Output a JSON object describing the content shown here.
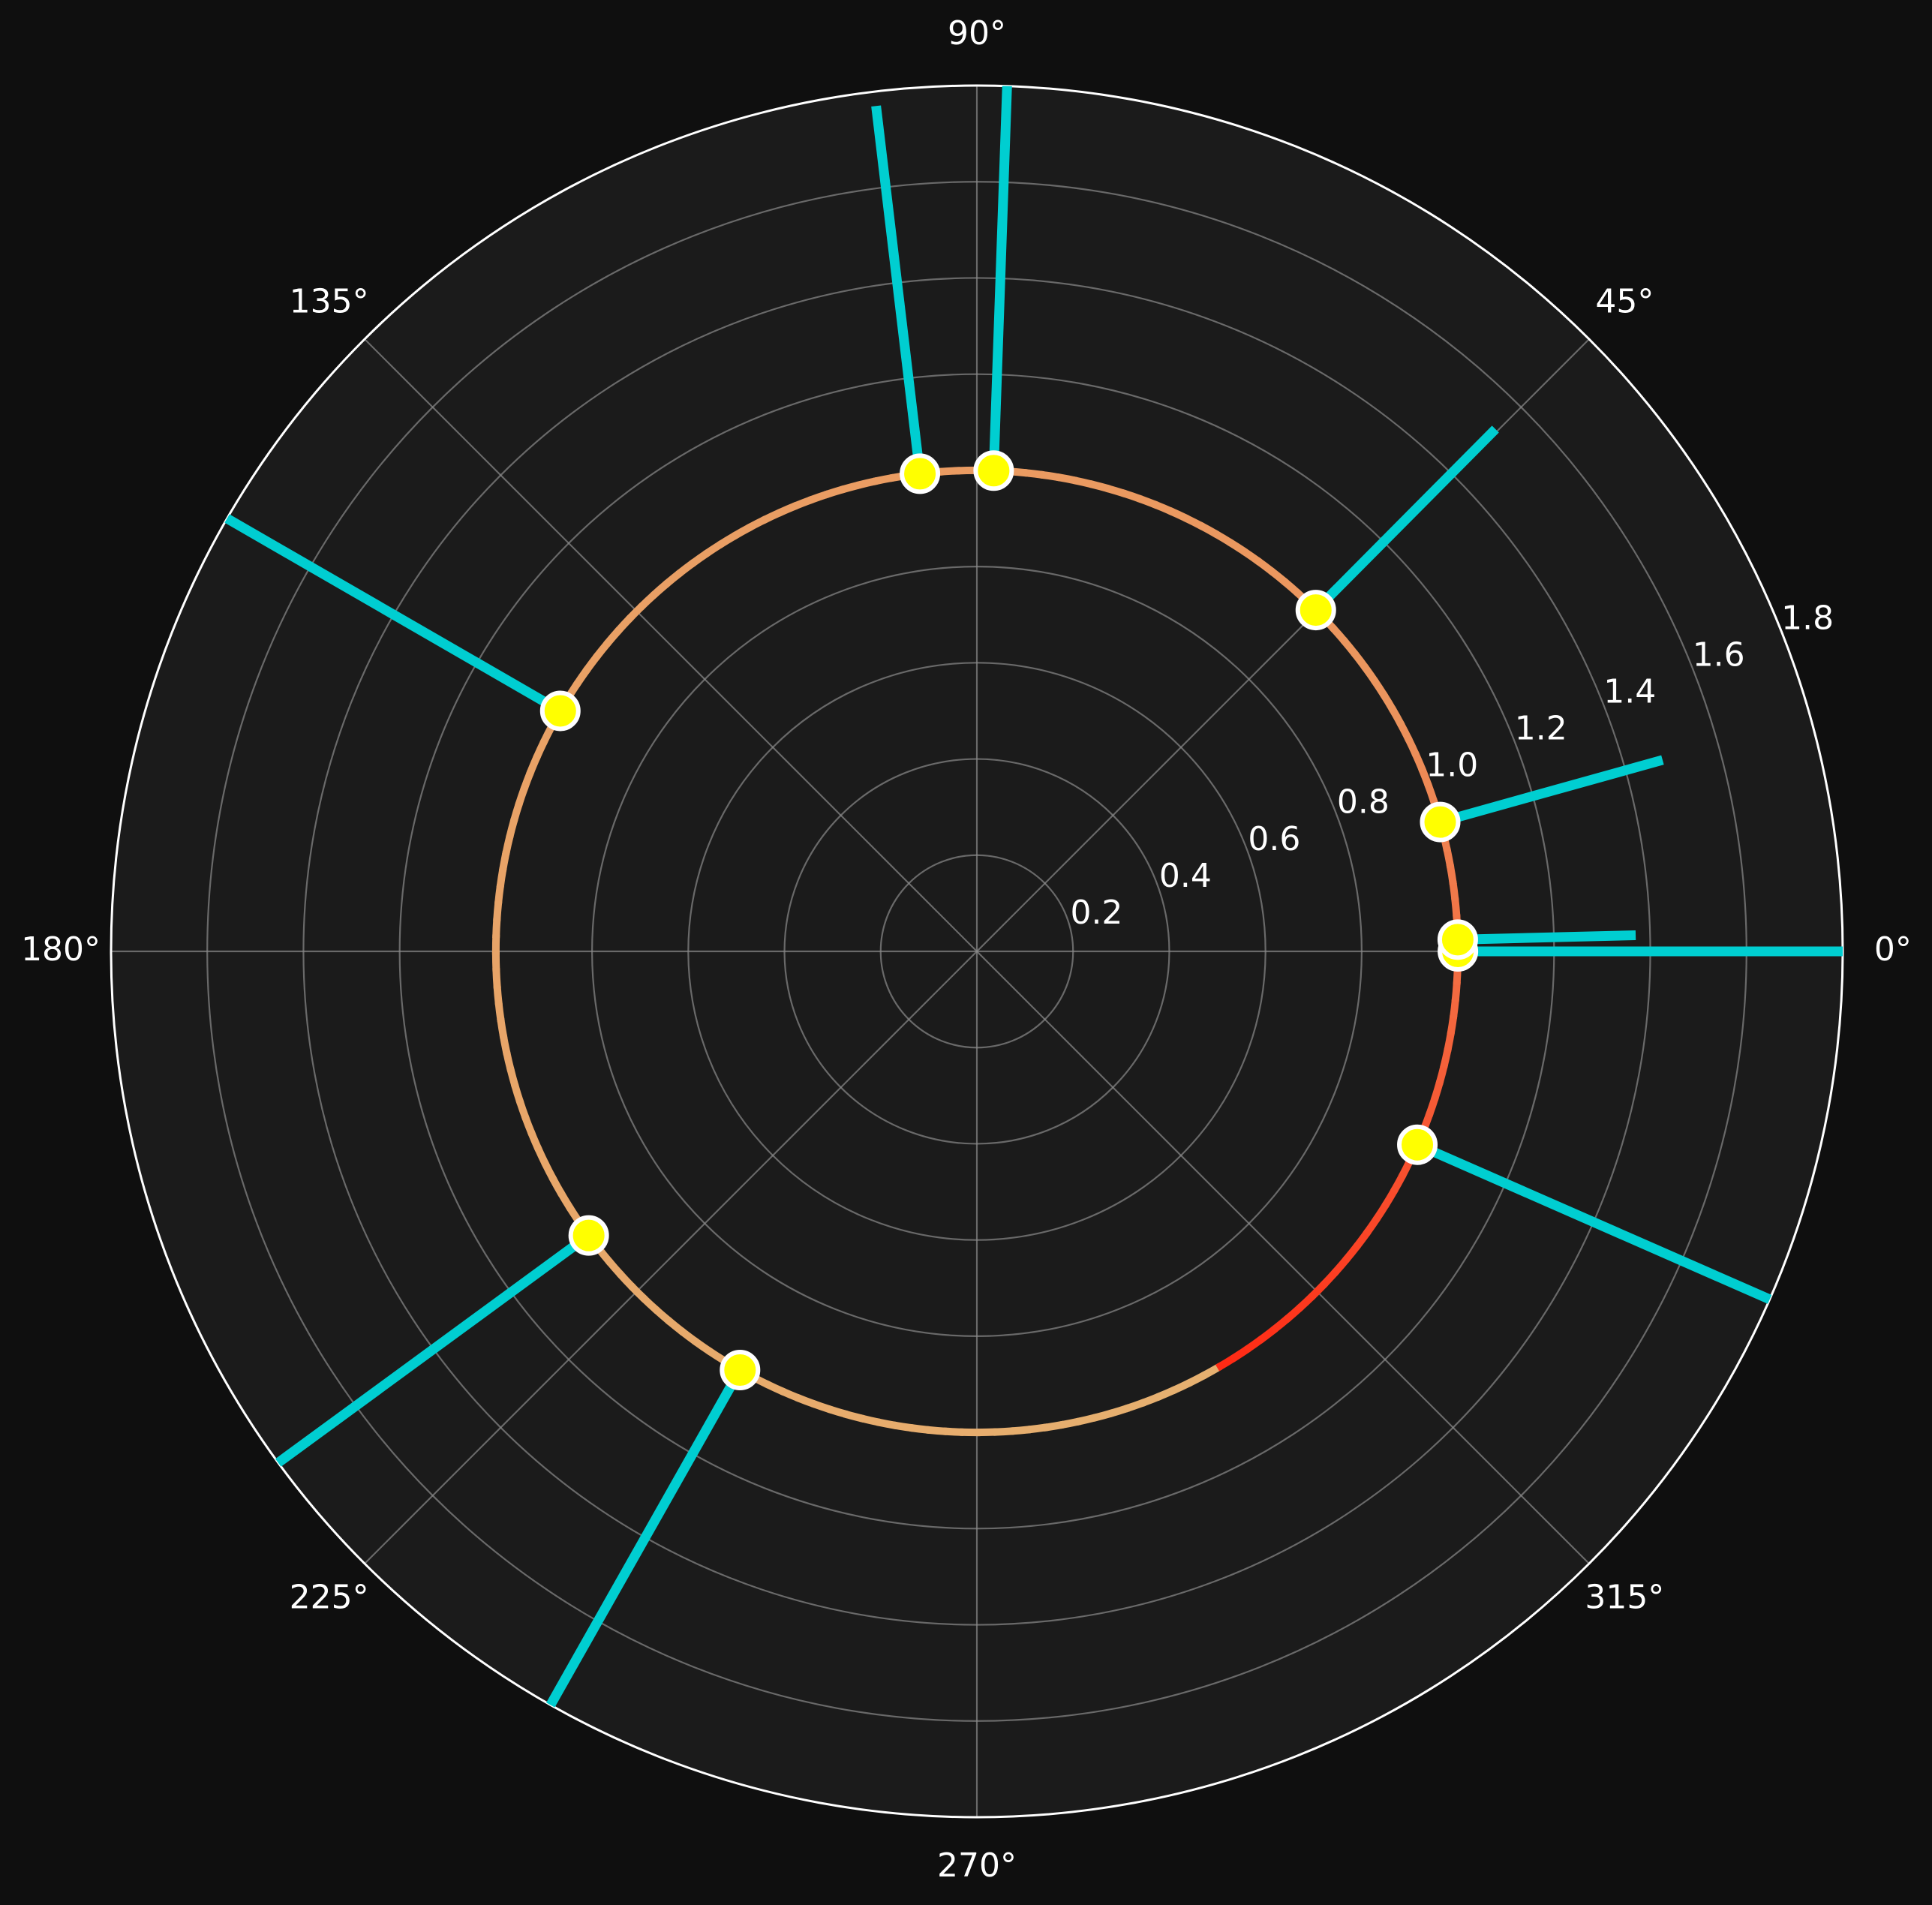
{
  "chart_data": {
    "type": "polar",
    "theta_tick_labels": [
      "0°",
      "45°",
      "90°",
      "135°",
      "180°",
      "225°",
      "270°",
      "315°"
    ],
    "theta_ticks_deg": [
      0,
      45,
      90,
      135,
      180,
      225,
      270,
      315
    ],
    "r_tick_labels": [
      "0.2",
      "0.4",
      "0.6",
      "0.8",
      "1.0",
      "1.2",
      "1.4",
      "1.6",
      "1.8"
    ],
    "r_ticks": [
      0.2,
      0.4,
      0.6,
      0.8,
      1.0,
      1.2,
      1.4,
      1.6,
      1.8
    ],
    "rlim": [
      0,
      1.8
    ],
    "rlabel_position_deg": 22.5,
    "grid": true,
    "circle": {
      "r": 1.0,
      "color_start": "#ff2a14",
      "color_end": "#e6b070",
      "start_angle_deg": 0
    },
    "points": [
      {
        "theta_deg": 0.0,
        "r": 1.0
      },
      {
        "theta_deg": 1.4,
        "r": 1.0
      },
      {
        "theta_deg": 15.6,
        "r": 1.0
      },
      {
        "theta_deg": 45.2,
        "r": 1.0
      },
      {
        "theta_deg": 88.0,
        "r": 1.0
      },
      {
        "theta_deg": 96.8,
        "r": 1.0
      },
      {
        "theta_deg": 150.0,
        "r": 1.0
      },
      {
        "theta_deg": 216.2,
        "r": 1.0
      },
      {
        "theta_deg": 240.5,
        "r": 1.0
      },
      {
        "theta_deg": 336.3,
        "r": 1.0
      }
    ],
    "stems": [
      {
        "theta_deg": 0.0,
        "r_inner": 1.0,
        "r_outer": 1.8
      },
      {
        "theta_deg": 1.4,
        "r_inner": 1.0,
        "r_outer": 1.37
      },
      {
        "theta_deg": 15.6,
        "r_inner": 1.0,
        "r_outer": 1.48
      },
      {
        "theta_deg": 45.2,
        "r_inner": 1.0,
        "r_outer": 1.53
      },
      {
        "theta_deg": 88.0,
        "r_inner": 1.0,
        "r_outer": 1.8
      },
      {
        "theta_deg": 96.8,
        "r_inner": 1.0,
        "r_outer": 1.77
      },
      {
        "theta_deg": 150.0,
        "r_inner": 1.0,
        "r_outer": 1.8
      },
      {
        "theta_deg": 216.2,
        "r_inner": 1.0,
        "r_outer": 1.8
      },
      {
        "theta_deg": 240.5,
        "r_inner": 1.0,
        "r_outer": 1.8
      },
      {
        "theta_deg": 336.3,
        "r_inner": 1.0,
        "r_outer": 1.8
      }
    ],
    "colors": {
      "background": "#0f0f0f",
      "axes_face": "#1b1b1b",
      "grid": "#8a8a8a",
      "spine": "#ffffff",
      "stem": "#00ced1",
      "marker_fill": "#ffff00",
      "marker_edge": "#ffffff",
      "text": "#ffffff"
    }
  }
}
